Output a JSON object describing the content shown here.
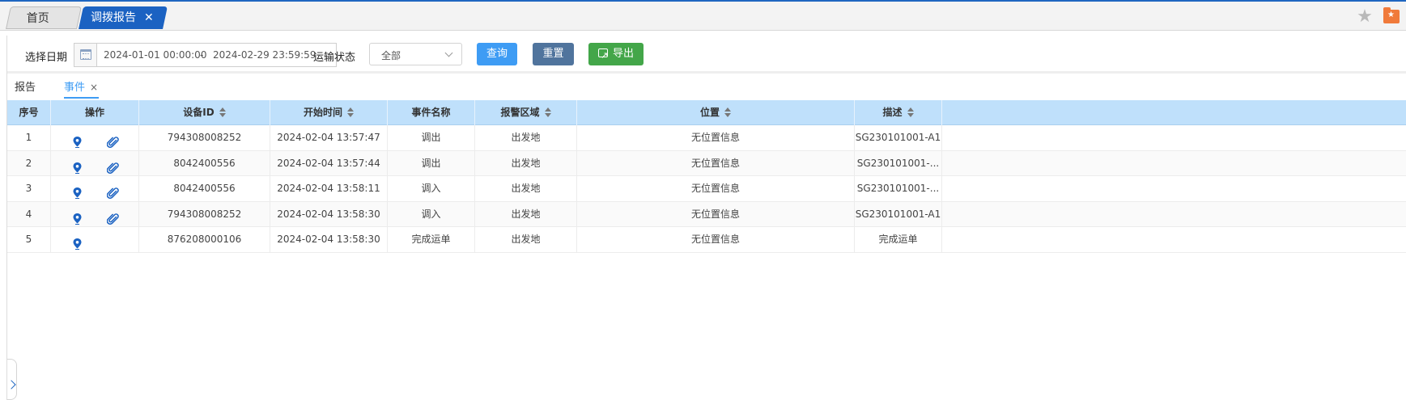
{
  "tabs": {
    "home": "首页",
    "active": "调拨报告",
    "close": "✕"
  },
  "filters": {
    "date_label": "选择日期",
    "date_start": "2024-01-01 00:00:00",
    "date_sep": "-",
    "date_end": "2024-02-29 23:59:59",
    "status_label": "运输状态",
    "status_value": "全部",
    "query_label": "查询",
    "reset_label": "重置",
    "export_label": "导出"
  },
  "subtabs": {
    "report": "报告",
    "event": "事件",
    "close": "×"
  },
  "columns": [
    "序号",
    "操作",
    "设备ID",
    "开始时间",
    "事件名称",
    "报警区域",
    "位置",
    "描述"
  ],
  "rows": [
    {
      "no": "1",
      "device": "794308008252",
      "time": "2024-02-04 13:57:47",
      "event": "调出",
      "area": "出发地",
      "location": "无位置信息",
      "desc": "SG230101001-A1",
      "has_attachment": true
    },
    {
      "no": "2",
      "device": "8042400556",
      "time": "2024-02-04 13:57:44",
      "event": "调出",
      "area": "出发地",
      "location": "无位置信息",
      "desc": "SG230101001-...",
      "has_attachment": true
    },
    {
      "no": "3",
      "device": "8042400556",
      "time": "2024-02-04 13:58:11",
      "event": "调入",
      "area": "出发地",
      "location": "无位置信息",
      "desc": "SG230101001-...",
      "has_attachment": true
    },
    {
      "no": "4",
      "device": "794308008252",
      "time": "2024-02-04 13:58:30",
      "event": "调入",
      "area": "出发地",
      "location": "无位置信息",
      "desc": "SG230101001-A1",
      "has_attachment": true
    },
    {
      "no": "5",
      "device": "876208000106",
      "time": "2024-02-04 13:58:30",
      "event": "完成运单",
      "area": "出发地",
      "location": "无位置信息",
      "desc": "完成运单",
      "has_attachment": false
    }
  ],
  "colors": {
    "accent": "#1b62c2",
    "query": "#3e9cf4",
    "reset": "#50749d",
    "export": "#43a649",
    "header_bg": "#bfe0fb"
  }
}
